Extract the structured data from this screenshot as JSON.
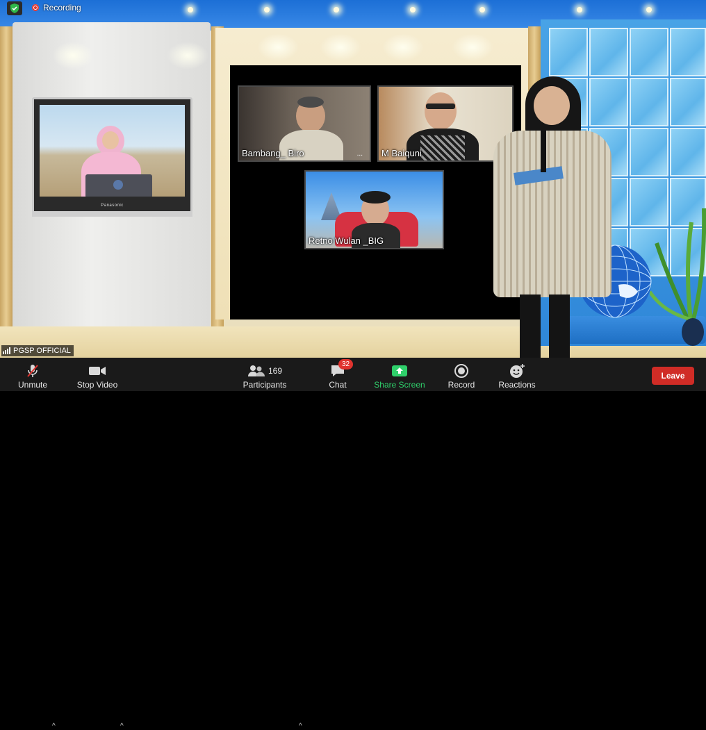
{
  "recording": {
    "label": "Recording"
  },
  "self_view": {
    "name": "PGSP OFFICIAL"
  },
  "tv": {
    "brand": "Panasonic"
  },
  "participants": [
    {
      "name": "Bambang_ Biro",
      "more": "..."
    },
    {
      "name": "M Baiquni"
    },
    {
      "name": "Retno Wulan _BIG"
    }
  ],
  "toolbar": {
    "unmute_label": "Unmute",
    "stop_video_label": "Stop Video",
    "participants_label": "Participants",
    "participants_count": "169",
    "chat_label": "Chat",
    "chat_badge": "32",
    "share_label": "Share Screen",
    "record_label": "Record",
    "reactions_label": "Reactions",
    "leave_label": "Leave"
  },
  "colors": {
    "share_green": "#2fd06b",
    "leave_red": "#d02c26",
    "toolbar_bg": "#1a1a1a"
  },
  "icons": {
    "security": "shield-check-icon",
    "recording": "record-dot-icon",
    "signal": "signal-bars-icon",
    "mic": "mic-muted-icon",
    "video": "video-camera-icon",
    "participants": "people-icon",
    "chat": "chat-bubble-icon",
    "share": "share-arrow-icon",
    "record": "record-circle-icon",
    "reactions": "smiley-plus-icon"
  }
}
